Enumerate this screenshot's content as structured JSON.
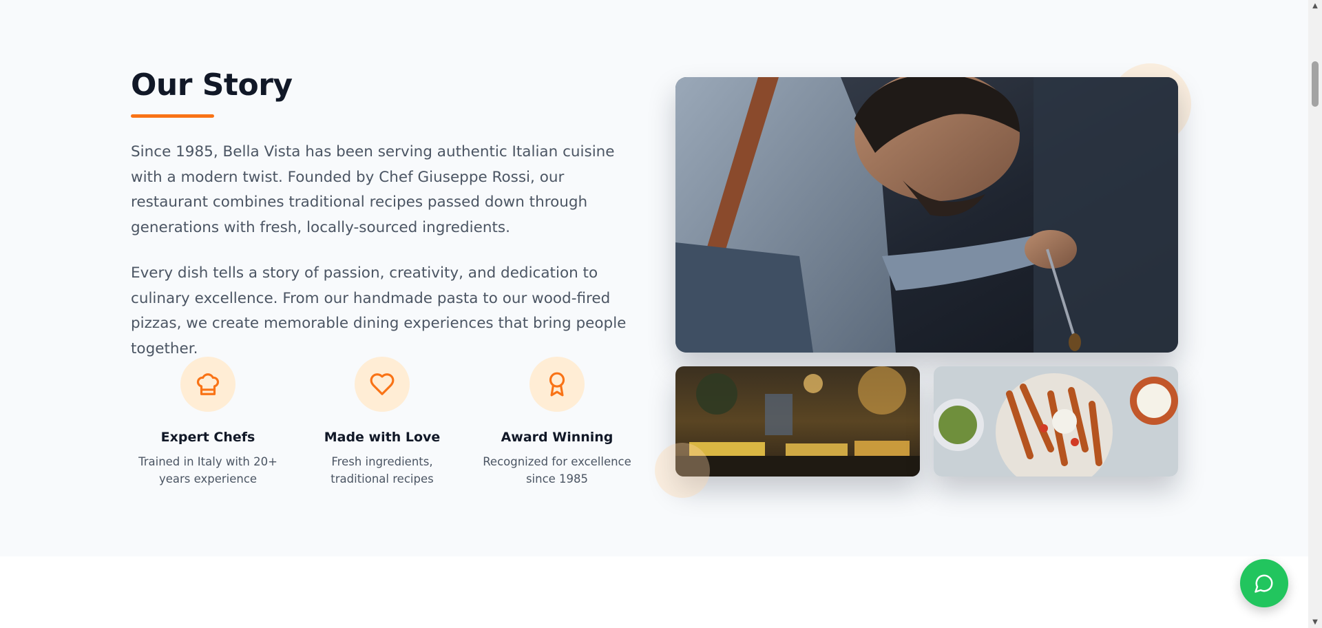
{
  "story": {
    "title": "Our Story",
    "paragraph_1": "Since 1985, Bella Vista has been serving authentic Italian cuisine with a modern twist. Founded by Chef Giuseppe Rossi, our restaurant combines traditional recipes passed down through generations with fresh, locally-sourced ingredients.",
    "paragraph_2": "Every dish tells a story of passion, creativity, and dedication to culinary excellence. From our handmade pasta to our wood-fired pizzas, we create memorable dining experiences that bring people together."
  },
  "features": [
    {
      "icon": "chef-hat-icon",
      "title": "Expert Chefs",
      "description": "Trained in Italy with 20+ years experience"
    },
    {
      "icon": "heart-icon",
      "title": "Made with Love",
      "description": "Fresh ingredients, traditional recipes"
    },
    {
      "icon": "award-icon",
      "title": "Award Winning",
      "description": "Recognized for excellence since 1985"
    }
  ],
  "images": {
    "main": "chef-plating-photo",
    "small_1": "restaurant-interior-photo",
    "small_2": "food-platter-photo"
  },
  "chat": {
    "icon": "chat-bubble-icon"
  },
  "colors": {
    "accent": "#f97316",
    "accent_soft": "#ffedd5",
    "heading": "#111827",
    "body_text": "#4b5563",
    "section_bg": "#f8fafc",
    "chat_green": "#22c55e"
  }
}
